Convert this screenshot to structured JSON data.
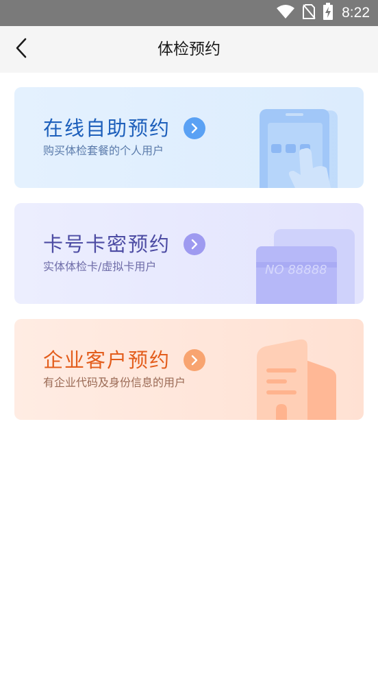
{
  "status_bar": {
    "time": "8:22",
    "icons": [
      "wifi-icon",
      "no-sim-icon",
      "battery-charging-icon"
    ]
  },
  "header": {
    "title": "体检预约",
    "back_icon": "chevron-left-icon"
  },
  "cards": [
    {
      "title": "在线自助预约",
      "subtitle": "购买体检套餐的个人用户",
      "accent": "#1d5fbb",
      "icon": "touch-screen-icon"
    },
    {
      "title": "卡号卡密预约",
      "subtitle": "实体体检卡/虚拟卡用户",
      "accent": "#4c4ba3",
      "icon": "card-icon",
      "card_text": "NO 88888"
    },
    {
      "title": "企业客户预约",
      "subtitle": "有企业代码及身份信息的用户",
      "accent": "#e35d1c",
      "icon": "building-icon"
    }
  ]
}
